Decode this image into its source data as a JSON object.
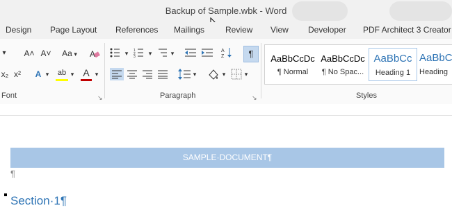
{
  "window": {
    "title": "Backup of Sample.wbk - Word"
  },
  "tabs": [
    "Design",
    "Page Layout",
    "References",
    "Mailings",
    "Review",
    "View",
    "Developer",
    "PDF Architect 3 Creator"
  ],
  "ribbon": {
    "font_group_label": "Font",
    "paragraph_group_label": "Paragraph",
    "styles_group_label": "Styles",
    "grow_font": "A˄",
    "shrink_font": "A˅",
    "change_case": "Aa",
    "subscript": "x₂",
    "superscript": "x²",
    "text_effects": "A",
    "highlight": "ab",
    "font_color": "A",
    "show_marks": "¶",
    "colors": {
      "highlight": "#ffff00",
      "font_color": "#c00000",
      "show_marks_bg": "#c5d9ef"
    }
  },
  "styles": [
    {
      "sample": "AaBbCcDc",
      "name": "¶ Normal"
    },
    {
      "sample": "AaBbCcDc",
      "name": "¶ No Spac..."
    },
    {
      "sample": "AaBbCc",
      "name": "Heading 1"
    },
    {
      "sample": "AaBbC",
      "name": "Heading"
    }
  ],
  "document": {
    "banner_text": "SAMPLE·DOCUMENT¶",
    "empty_paragraph": "¶",
    "section_heading": "Section·1¶"
  },
  "colors": {
    "accent": "#2e74b5",
    "banner": "#a8c6e6"
  }
}
